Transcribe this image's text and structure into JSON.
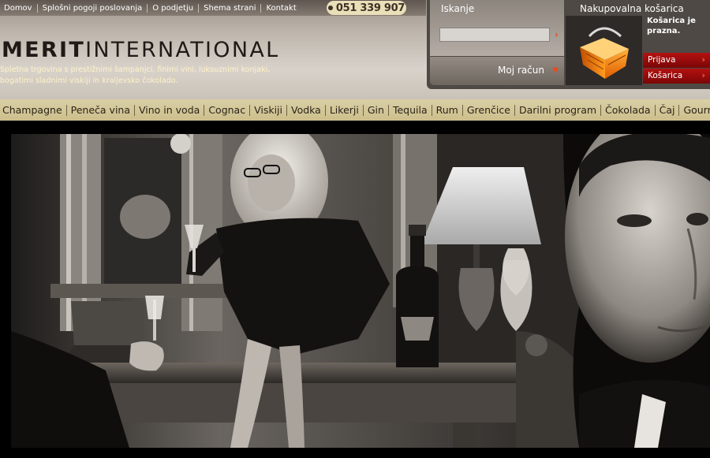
{
  "topnav": {
    "items": [
      "Domov",
      "Splošni pogoji poslovanja",
      "O podjetju",
      "Shema strani",
      "Kontakt"
    ]
  },
  "phone": "051 339 907",
  "logo": {
    "part1": "MERIT",
    "part2": "INTERNATIONAL"
  },
  "tagline": "Spletna trgovina s prestižnimi šampanjci, finimi vini, luksuznimi konjaki, bogatimi sladnimi viskiji in kraljevsko čokolado.",
  "search": {
    "label": "Iskanje",
    "value": "",
    "go_icon": "arrow-right-icon"
  },
  "account": {
    "label": "Moj račun",
    "icon": "chevron-down-icon"
  },
  "cart": {
    "title": "Nakupovalna košarica",
    "status": "Košarica je prazna.",
    "icon": "shopping-basket-icon",
    "buttons": [
      "Prijava",
      "Košarica"
    ]
  },
  "categories": [
    "Champagne",
    "Peneča vina",
    "Vino in voda",
    "Cognac",
    "Viskiji",
    "Vodka",
    "Likerji",
    "Gin",
    "Tequila",
    "Rum",
    "Grenčice",
    "Darilni program",
    "Čokolada",
    "Čaj",
    "Gourmet"
  ],
  "colors": {
    "accent_red": "#b51111",
    "arrow_orange": "#e84b1c",
    "category_bar": "#d4c898",
    "tagline": "#fff2c8"
  }
}
